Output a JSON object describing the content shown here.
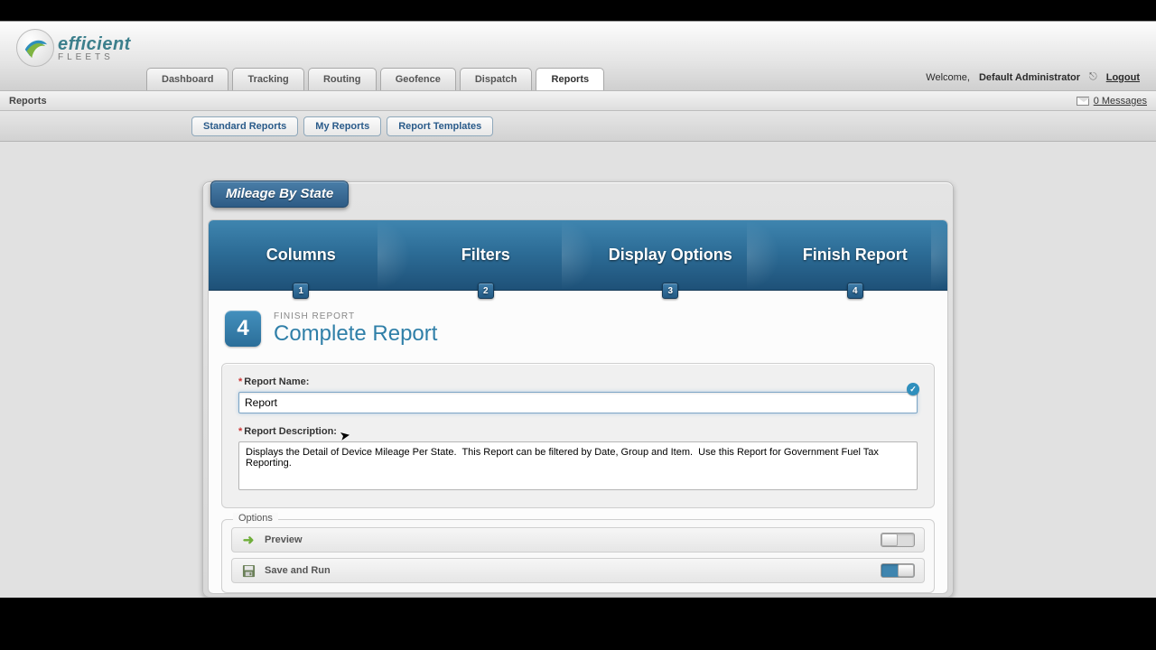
{
  "brand": {
    "line1": "efficient",
    "line2": "FLEETS"
  },
  "main_tabs": [
    "Dashboard",
    "Tracking",
    "Routing",
    "Geofence",
    "Dispatch",
    "Reports"
  ],
  "main_tab_active": 5,
  "welcome_prefix": "Welcome,",
  "welcome_user": "Default Administrator",
  "logout_label": "Logout",
  "crumb": "Reports",
  "messages_label": "0 Messages",
  "sub_tabs": [
    "Standard Reports",
    "My Reports",
    "Report Templates"
  ],
  "panel_title": "Mileage By State",
  "wizard_steps": [
    "Columns",
    "Filters",
    "Display Options",
    "Finish Report"
  ],
  "step": {
    "number": "4",
    "eyebrow": "FINISH REPORT",
    "title": "Complete Report"
  },
  "form": {
    "name_label": "Report Name:",
    "name_value": "Report",
    "desc_label": "Report Description:",
    "desc_value": "Displays the Detail of Device Mileage Per State.  This Report can be filtered by Date, Group and Item.  Use this Report for Government Fuel Tax Reporting."
  },
  "options": {
    "legend": "Options",
    "preview": "Preview",
    "save_run": "Save and Run",
    "preview_on": false,
    "save_run_on": true
  }
}
